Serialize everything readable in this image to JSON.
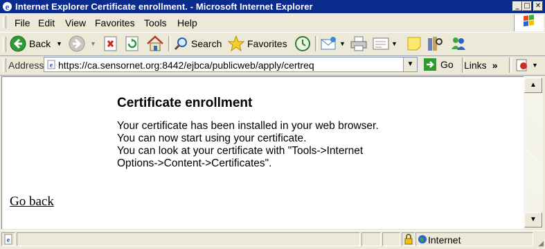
{
  "window": {
    "title": "Internet Explorer Certificate enrollment. - Microsoft Internet Explorer",
    "minimize_glyph": "_",
    "maximize_glyph": "□",
    "close_glyph": "✕"
  },
  "menu": {
    "items": [
      "File",
      "Edit",
      "View",
      "Favorites",
      "Tools",
      "Help"
    ]
  },
  "toolbar": {
    "back_label": "Back",
    "search_label": "Search",
    "favorites_label": "Favorites"
  },
  "address": {
    "label": "Address",
    "url": "https://ca.sensornet.org:8442/ejbca/publicweb/apply/certreq",
    "go_label": "Go",
    "links_label": "Links",
    "links_chevron": "»"
  },
  "page": {
    "heading": "Certificate enrollment",
    "lines": [
      "Your certificate has been installed in your web browser.",
      "You can now start using your certificate.",
      "You can look at your certificate with \"Tools->Internet",
      "Options->Content->Certificates\"."
    ],
    "go_back_link": "Go back"
  },
  "status": {
    "zone": "Internet"
  },
  "icons": {
    "ie": "ie-logo-icon",
    "back": "back-arrow-icon",
    "forward": "forward-arrow-icon",
    "stop": "stop-icon",
    "refresh": "refresh-icon",
    "home": "home-icon",
    "search": "search-icon",
    "favorites": "star-icon",
    "history": "history-icon",
    "mail": "mail-icon",
    "print": "print-icon",
    "edit": "edit-icon",
    "discuss": "note-icon",
    "research": "research-icon",
    "messenger": "messenger-icon"
  },
  "colors": {
    "titlebar": "#0b2c8c",
    "chrome": "#ece9d8",
    "go_green": "#2e9b2e",
    "back_green": "#2f9a36"
  }
}
